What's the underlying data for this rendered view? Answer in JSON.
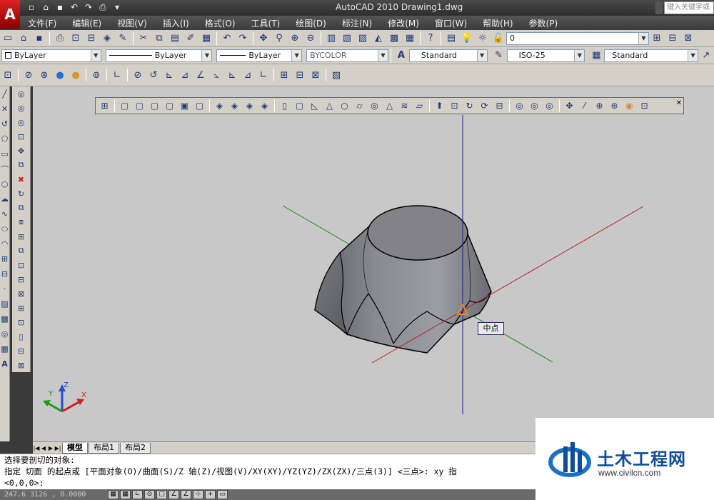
{
  "window": {
    "app_icon": "A",
    "title": "AutoCAD 2010    Drawing1.dwg",
    "search_placeholder": "键入关键字或"
  },
  "quick_access": [
    {
      "icon": "new-icon",
      "glyph": "▫"
    },
    {
      "icon": "open-icon",
      "glyph": "⌂"
    },
    {
      "icon": "save-icon",
      "glyph": "▪"
    },
    {
      "icon": "undo-icon",
      "glyph": "↶"
    },
    {
      "icon": "redo-icon",
      "glyph": "↷"
    },
    {
      "icon": "print-icon",
      "glyph": "⎙"
    }
  ],
  "menu": [
    "文件(F)",
    "编辑(E)",
    "视图(V)",
    "插入(I)",
    "格式(O)",
    "工具(T)",
    "绘图(D)",
    "标注(N)",
    "修改(M)",
    "窗口(W)",
    "帮助(H)",
    "参数(P)"
  ],
  "standard_toolbar": {
    "layer_value": "0"
  },
  "properties_toolbar": {
    "color": "ByLayer",
    "linetype": "ByLayer",
    "lineweight": "ByLayer",
    "plotstyle": "BYCOLOR",
    "text_style": "Standard",
    "dim_style": "ISO-25",
    "table_style": "Standard"
  },
  "tooltip": {
    "text": "中点"
  },
  "ucs_icon": {
    "x": "X",
    "y": "Y",
    "z": "Z"
  },
  "layout_tabs": [
    {
      "label": "模型",
      "active": true
    },
    {
      "label": "布局1",
      "active": false
    },
    {
      "label": "布局2",
      "active": false
    }
  ],
  "command_line": {
    "line1": "选择要剖切的对象:",
    "line2": "指定 切面 的起点或 [平面对象(O)/曲面(S)/Z 轴(Z)/视图(V)/XY(XY)/YZ(YZ)/ZX(ZX)/三点(3)] <三点>: xy 指",
    "line3": "<0,0,0>:"
  },
  "status": {
    "coords": "247.6 3126 , 0.0000"
  },
  "watermark": {
    "title": "土木工程网",
    "url": "www.civilcn.com"
  },
  "colors": {
    "viewport_bg": "#c8c8c8",
    "axis_x": "#b02020",
    "axis_y": "#1a8a1a",
    "axis_z": "#1a1a9a",
    "solid_fill": "#7c7c84",
    "brand_blue": "#0d4d9a"
  }
}
